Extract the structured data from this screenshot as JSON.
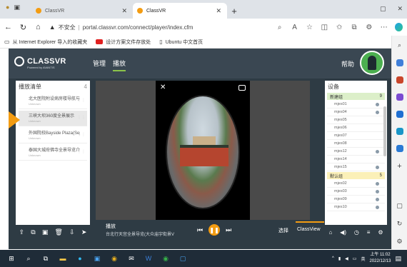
{
  "browser": {
    "tabs": [
      {
        "title": "ClassVR",
        "active": false
      },
      {
        "title": "ClassVR",
        "active": true
      }
    ],
    "url_security": "不安全",
    "url": "portal.classvr.com/connect/player/index.cfm",
    "favorites": [
      {
        "label": "从 Internet Explorer 导入的收藏夹"
      },
      {
        "label": "设计方案文件存放处"
      },
      {
        "label": "Ubuntu 中文首页"
      }
    ]
  },
  "app": {
    "logo_name": "CLASSVR",
    "logo_sub": "Powered by AVANTIS",
    "nav": [
      {
        "label": "管理",
        "active": false
      },
      {
        "label": "播放",
        "active": true
      }
    ],
    "help": "帮助",
    "avatar_color": "#4caf50"
  },
  "playlist": {
    "header": "播放清单",
    "count": "4",
    "items": [
      {
        "title": "北大医院附设病房楼导航与介绍…",
        "sub": "Unknown",
        "selected": false
      },
      {
        "title": "三峡大坝360度全景展示",
        "sub": "Unknown",
        "selected": true
      },
      {
        "title": "外国院校Bayside Plaza(Sepore…",
        "sub": "Unknown",
        "selected": false
      },
      {
        "title": "泰国大城府佛寺全景导览介绍…",
        "sub": "Unknown",
        "selected": false
      }
    ],
    "toolbar": [
      "upload",
      "share",
      "save",
      "delete",
      "download",
      "play"
    ]
  },
  "player": {
    "label": "播放",
    "description": "台北行天宫全景导览(大众庙宇街景VR全景导…",
    "select_label": "选择",
    "classview_label": "ClassView",
    "accent": "#f39c12"
  },
  "devices": {
    "header": "设备",
    "groups": [
      {
        "name": "新建组",
        "count": "9",
        "color": "#dcefc9",
        "items": [
          {
            "name": "mjes01",
            "online": true
          },
          {
            "name": "mjes04",
            "online": true
          },
          {
            "name": "mjes05",
            "online": false
          },
          {
            "name": "mjes06",
            "online": false
          },
          {
            "name": "mjes07",
            "online": false
          },
          {
            "name": "mjes08",
            "online": false
          },
          {
            "name": "mjes12",
            "online": true
          },
          {
            "name": "mjes14",
            "online": false
          },
          {
            "name": "mjes15",
            "online": true
          }
        ]
      },
      {
        "name": "默认组",
        "count": "5",
        "color": "#fbf0b8",
        "items": [
          {
            "name": "mjes02",
            "online": true
          },
          {
            "name": "mjes03",
            "online": true
          },
          {
            "name": "mjes09",
            "online": true
          },
          {
            "name": "mjes10",
            "online": true
          }
        ]
      }
    ],
    "toolbar": [
      "home",
      "volume",
      "timer",
      "filter",
      "settings"
    ]
  },
  "taskbar": {
    "time": "上午 11:02",
    "date": "2022/12/13"
  }
}
